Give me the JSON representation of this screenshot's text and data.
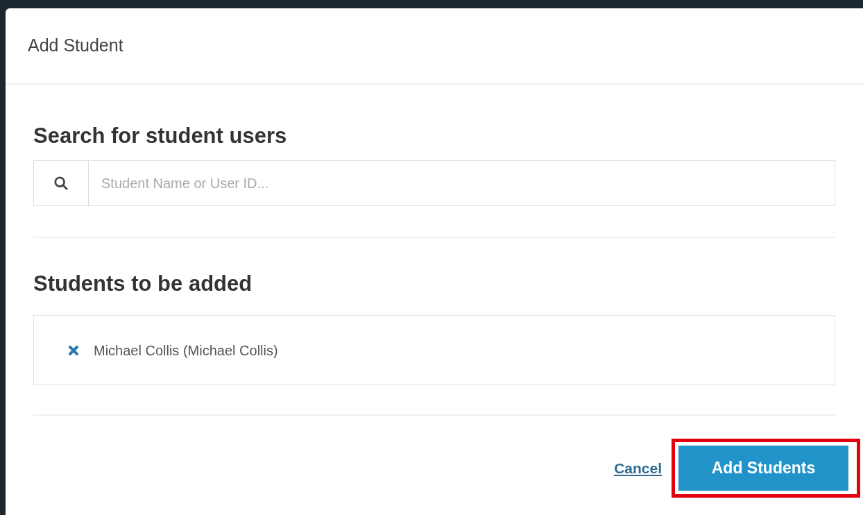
{
  "dialog": {
    "title": "Add Student"
  },
  "search_section": {
    "heading": "Search for student users",
    "search": {
      "placeholder": "Student Name or User ID..."
    }
  },
  "added_section": {
    "heading": "Students to be added",
    "students": [
      {
        "name": "Michael Collis (Michael Collis)"
      }
    ]
  },
  "footer": {
    "cancel": "Cancel",
    "submit": {
      "label": "Add Students",
      "highlighted": true
    }
  }
}
